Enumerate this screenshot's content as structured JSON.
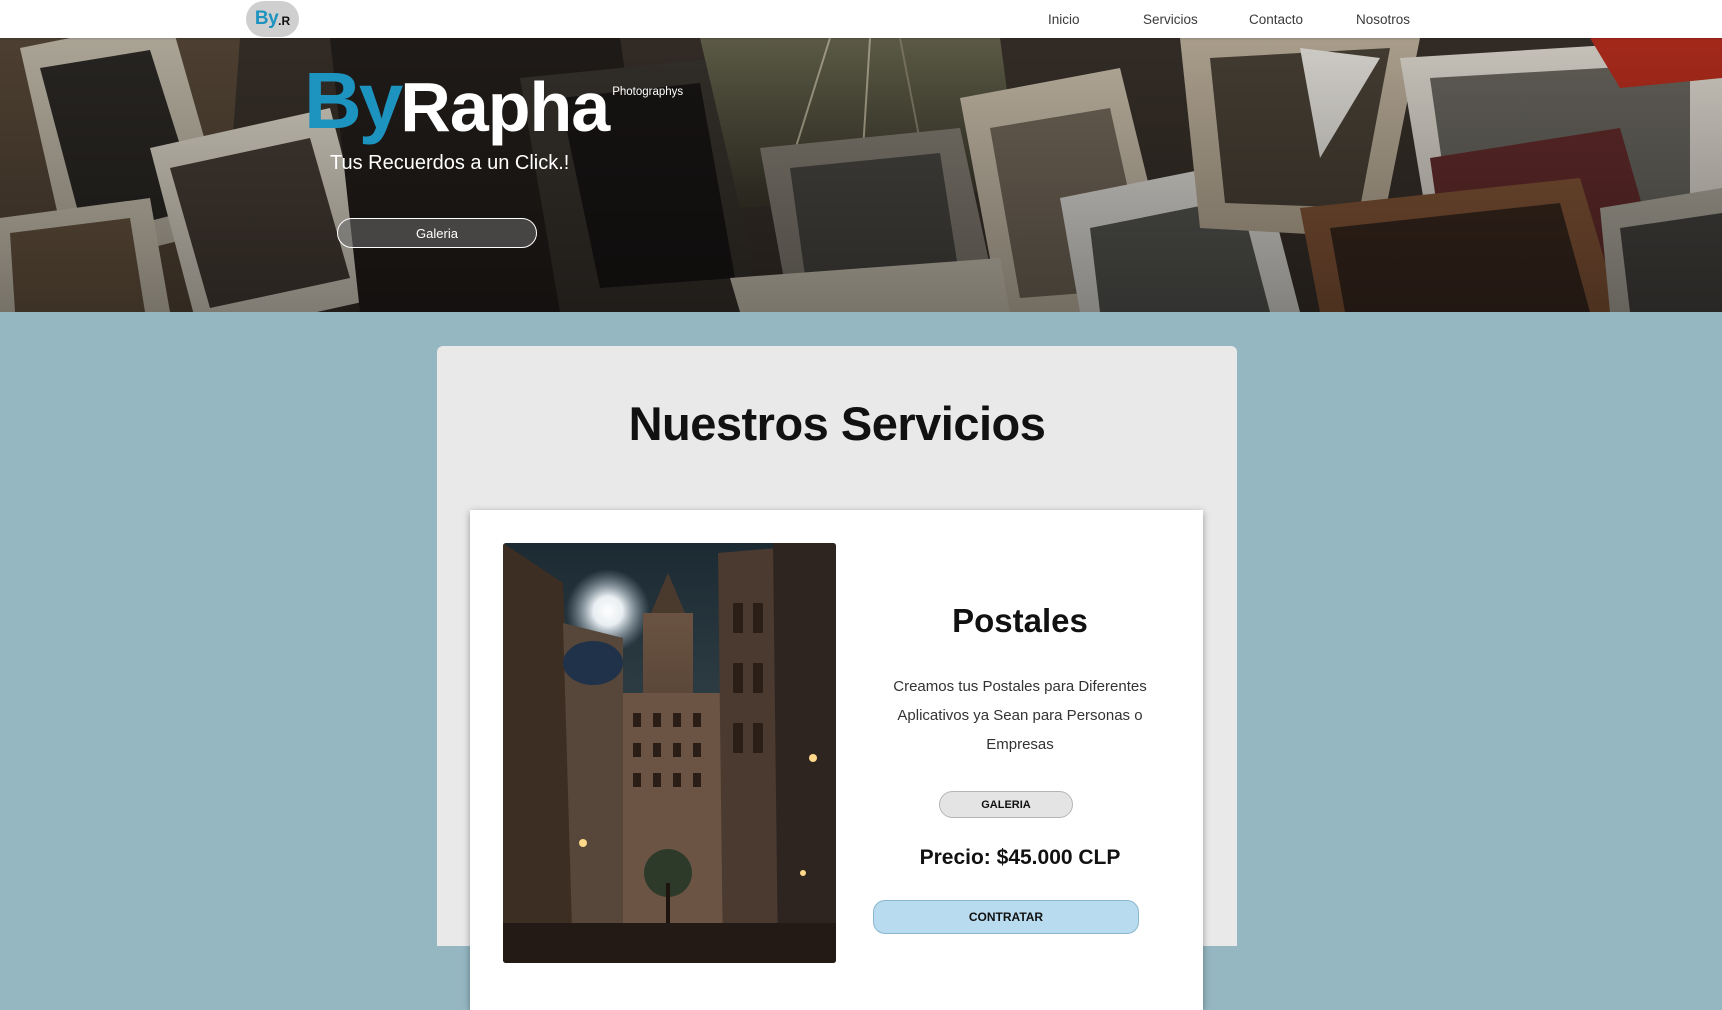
{
  "nav": {
    "logo_by": "By",
    "logo_r": ".R",
    "links": [
      "Inicio",
      "Servicios",
      "Contacto",
      "Nosotros"
    ]
  },
  "hero": {
    "brand_by": "By",
    "brand_rapha": "Rapha",
    "brand_sub": "Photographys",
    "tagline": "Tus Recuerdos a un Click.!",
    "button_label": "Galeria"
  },
  "services": {
    "title": "Nuestros Servicios",
    "card": {
      "title": "Postales",
      "description": "Creamos tus Postales para Diferentes Aplicativos ya Sean para Personas o Empresas",
      "gallery_button": "GALERIA",
      "price": "Precio: $45.000 CLP",
      "contract_button": "CONTRATAR"
    }
  },
  "colors": {
    "accent_blue": "#1d93c0",
    "page_bg": "#95b7c2",
    "panel_bg": "#e9e9e9",
    "contract_btn": "#b8dbef"
  }
}
